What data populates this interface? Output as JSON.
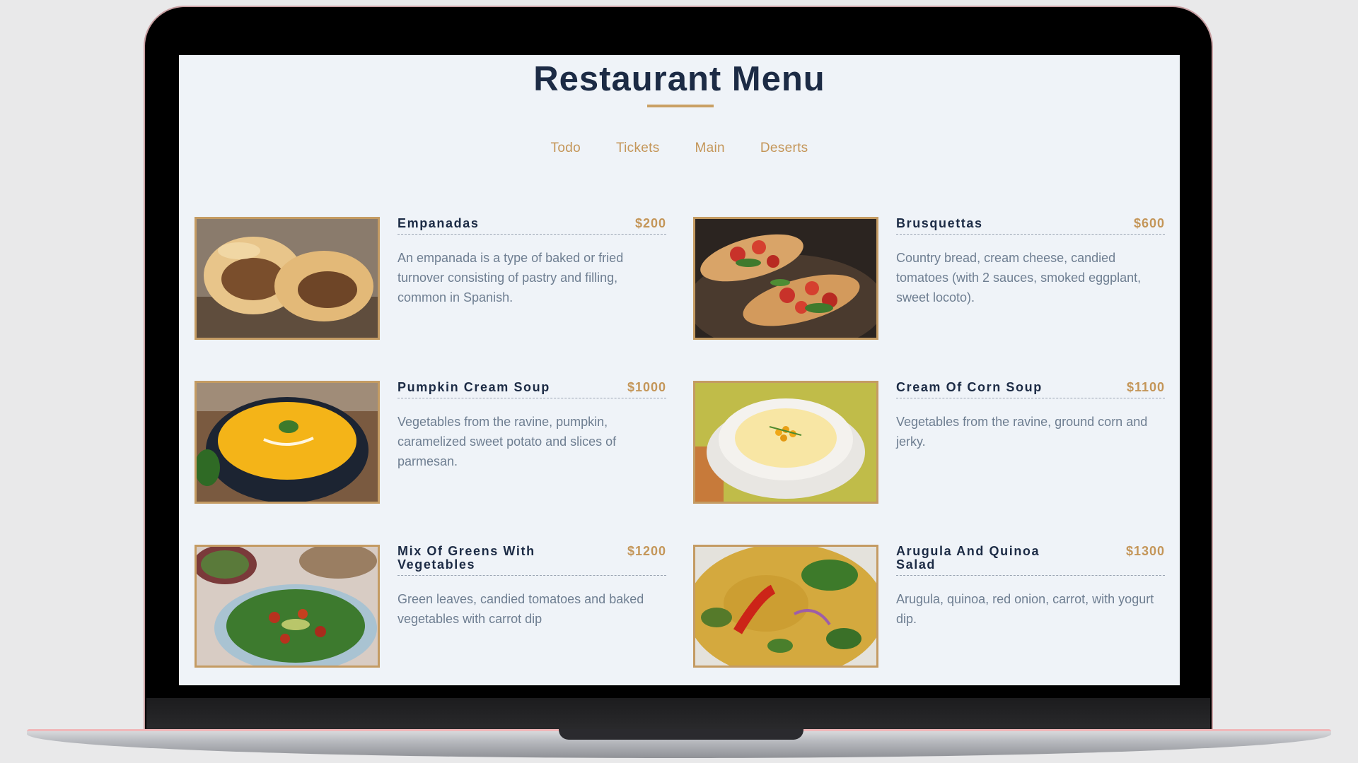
{
  "page": {
    "title": "Restaurant Menu",
    "accent_color": "#c49659",
    "title_color": "#1c2b45",
    "background": "#eff3f8"
  },
  "tabs": [
    "Todo",
    "Tickets",
    "Main",
    "Deserts"
  ],
  "menu": [
    {
      "name": "Empanadas",
      "price": "$200",
      "description": "An empanada is a type of baked or fried turnover consisting of pastry and filling, common in Spanish.",
      "image": "empanadas-photo"
    },
    {
      "name": "Brusquettas",
      "price": "$600",
      "description": "Country bread, cream cheese, candied tomatoes (with 2 sauces, smoked eggplant, sweet locoto).",
      "image": "bruschetta-photo"
    },
    {
      "name": "Pumpkin Cream Soup",
      "price": "$1000",
      "description": "Vegetables from the ravine, pumpkin, caramelized sweet potato and slices of parmesan.",
      "image": "pumpkin-soup-photo"
    },
    {
      "name": "Cream Of Corn Soup",
      "price": "$1100",
      "description": "Vegetables from the ravine, ground corn and jerky.",
      "image": "corn-soup-photo"
    },
    {
      "name": "Mix Of Greens With Vegetables",
      "price": "$1200",
      "description": "Green leaves, candied tomatoes and baked vegetables with carrot dip",
      "image": "greens-salad-photo"
    },
    {
      "name": "Arugula And Quinoa Salad",
      "price": "$1300",
      "description": "Arugula, quinoa, red onion, carrot, with yogurt dip.",
      "image": "quinoa-salad-photo"
    }
  ]
}
